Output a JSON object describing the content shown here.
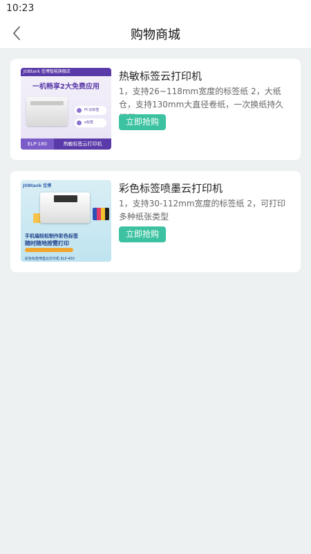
{
  "status_bar": {
    "time": "10:23"
  },
  "header": {
    "title": "购物商城"
  },
  "products": [
    {
      "name": "热敏标签云打印机",
      "description": "1，支持26~118mm宽度的标签纸 2，大纸仓，支持130mm大直径卷纸，一次换纸持久打印",
      "button_label": "立即抢购",
      "image": {
        "brand_strip": "JOBtank 佳博智能旗舰店",
        "headline": "一机畅享2大免费应用",
        "badge_1": "PC云标签",
        "badge_2": "e标签",
        "model": "ELP-180",
        "product_label": "热敏标签云打印机"
      }
    },
    {
      "name": "彩色标签喷墨云打印机",
      "description": "1，支持30-112mm宽度的标签纸 2，可打印多种纸张类型",
      "button_label": "立即抢购",
      "image": {
        "brand": "JOBtank 佳博",
        "tagline_1": "手机端轻松制作彩色标签",
        "tagline_2": "随时随地按需打印",
        "footer": "彩色标签喷墨云打印机 ELP-450"
      }
    }
  ],
  "colors": {
    "accent": "#3cc2a1",
    "background": "#eef1f1",
    "brand_purple": "#5a3aa8"
  }
}
